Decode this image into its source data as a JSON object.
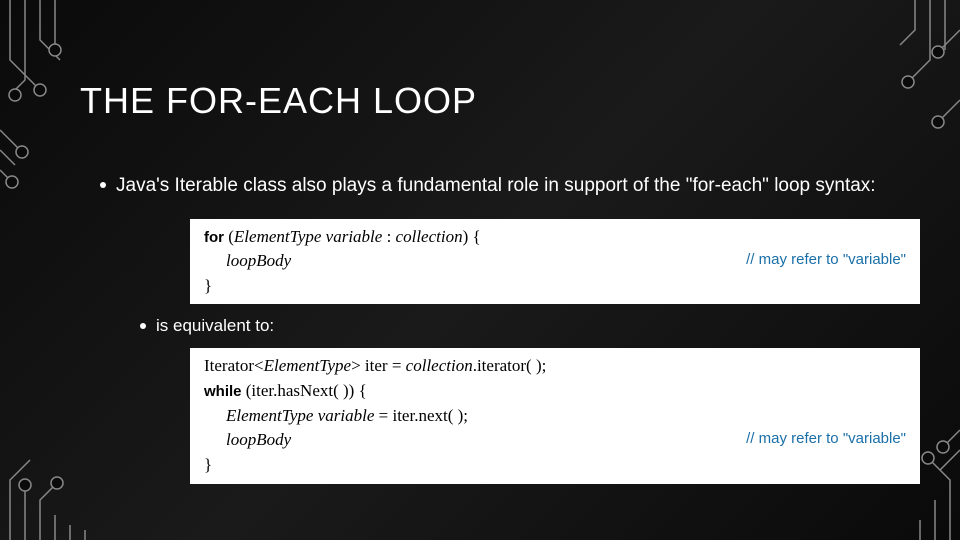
{
  "title": "THE FOR-EACH LOOP",
  "bullet1": "Java's Iterable class also plays a fundamental role in support of the \"for-each\" loop syntax:",
  "bullet2": "is equivalent to:",
  "code1": {
    "l1_kw": "for",
    "l1_rest": " (",
    "l1_it": "ElementType variable",
    "l1_mid": " : ",
    "l1_it2": "collection",
    "l1_end": ") {",
    "l2_it": "loopBody",
    "l2_comment": "// may refer to \"variable\"",
    "l3": "}"
  },
  "code2": {
    "l1_a": "Iterator<",
    "l1_it": "ElementType",
    "l1_b": "> iter = ",
    "l1_it2": "collection",
    "l1_c": ".iterator( );",
    "l2_kw": "while",
    "l2_rest": " (iter.hasNext( )) {",
    "l3_it": "ElementType variable",
    "l3_b": " = iter.next( );",
    "l4_it": "loopBody",
    "l4_comment": "// may refer to \"variable\"",
    "l5": "}"
  }
}
